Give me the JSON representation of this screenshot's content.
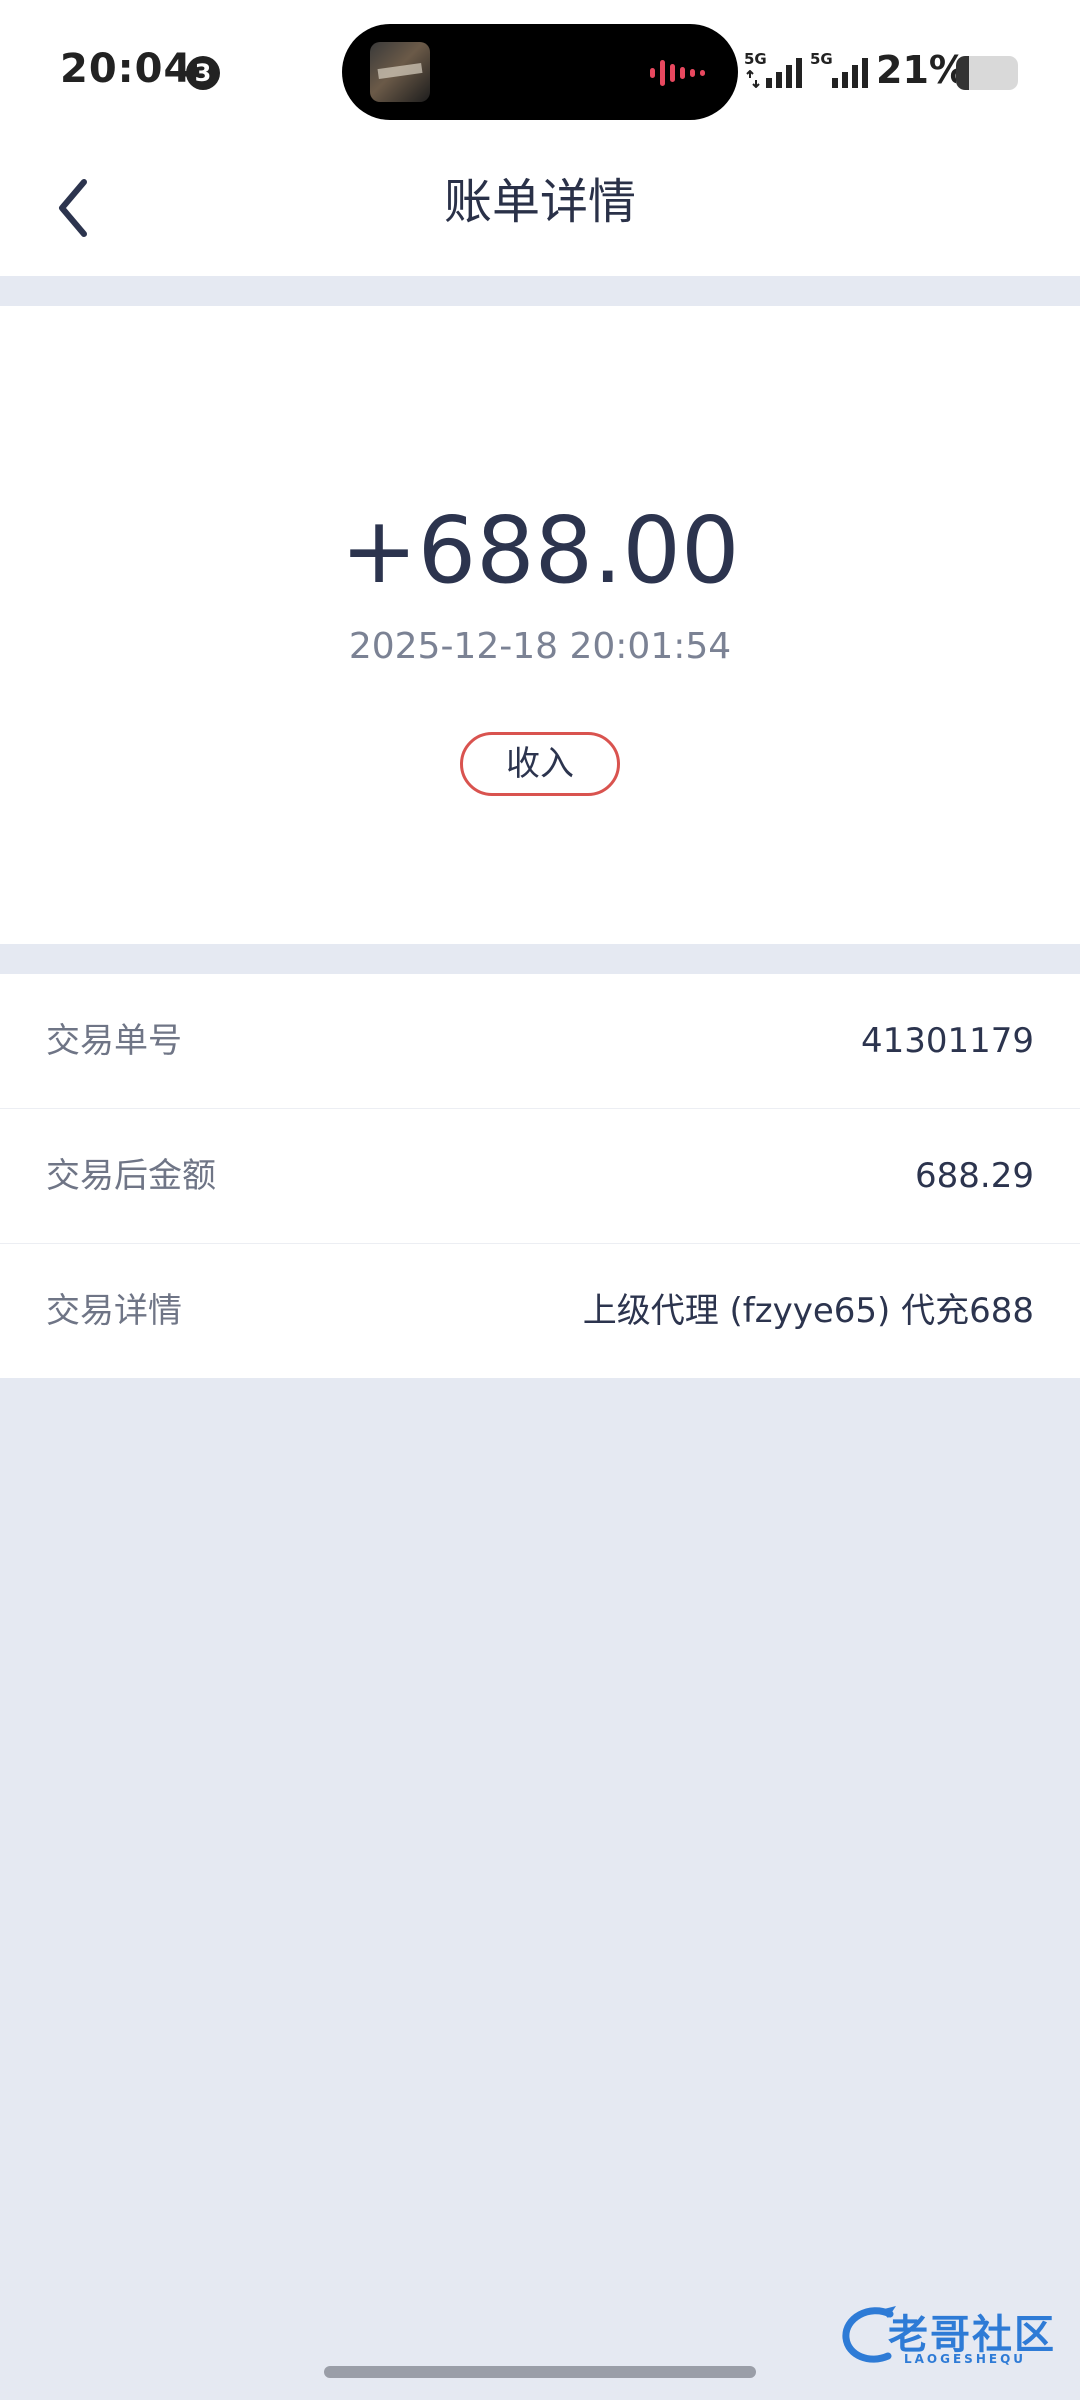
{
  "status_bar": {
    "time": "20:04",
    "notification_count": "3",
    "signal_1_label": "5G",
    "signal_2_label": "5G",
    "battery_percent": "21%",
    "battery_level": 0.21
  },
  "nav": {
    "title": "账单详情"
  },
  "summary": {
    "amount": "+688.00",
    "datetime": "2025-12-18 20:01:54",
    "type_badge": "收入",
    "badge_color": "#d9534f"
  },
  "details": [
    {
      "label": "交易单号",
      "value": "41301179"
    },
    {
      "label": "交易后金额",
      "value": "688.29"
    },
    {
      "label": "交易详情",
      "value": "上级代理 (fzyye65) 代充688"
    }
  ],
  "watermark": {
    "text": "老哥社区",
    "subtext": "LAOGESHEQU"
  },
  "colors": {
    "background": "#e5e9f2",
    "primary_text": "#2c344e",
    "secondary_text": "#6f7586",
    "watermark": "#2e7bd6"
  }
}
